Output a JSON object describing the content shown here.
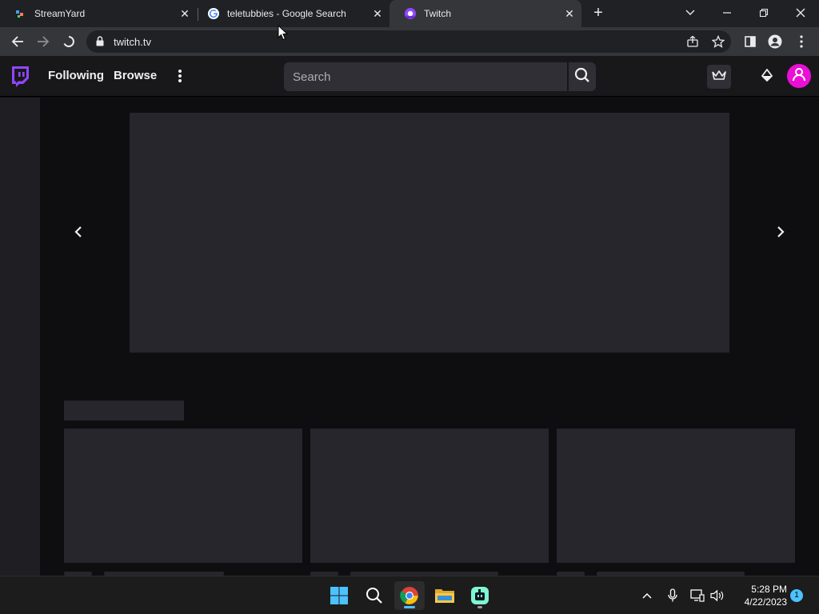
{
  "browser": {
    "tabs": [
      {
        "title": "StreamYard",
        "icon": "streamyard-icon",
        "active": false
      },
      {
        "title": "teletubbies - Google Search",
        "icon": "google-icon",
        "active": false
      },
      {
        "title": "Twitch",
        "icon": "twitch-icon",
        "active": true
      }
    ],
    "url": "twitch.tv"
  },
  "twitch": {
    "nav": {
      "following": "Following",
      "browse": "Browse"
    },
    "search": {
      "placeholder": "Search"
    },
    "colors": {
      "brand": "#9146ff",
      "avatar": "#eb0fd6",
      "skeleton": "#26262c"
    }
  },
  "taskbar": {
    "apps": [
      "windows-start-icon",
      "search-icon",
      "chrome-icon",
      "file-explorer-icon",
      "streamlabs-icon"
    ],
    "clock": {
      "time": "5:28 PM",
      "date": "4/22/2023"
    },
    "notification_count": "1"
  }
}
